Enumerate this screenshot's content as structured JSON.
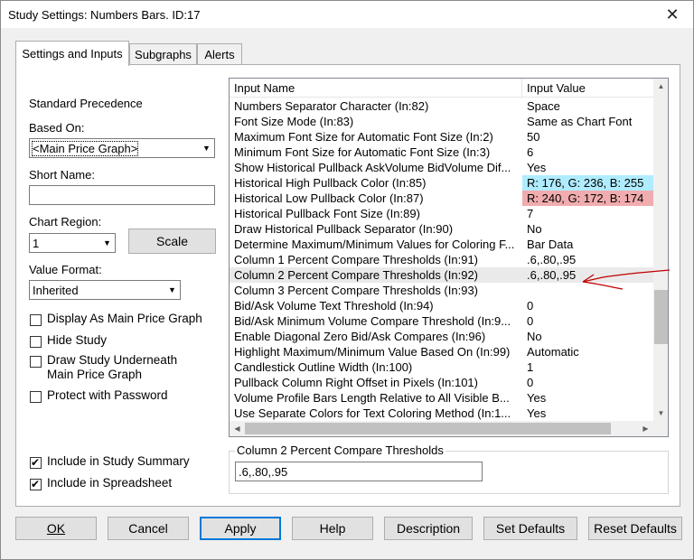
{
  "window": {
    "title": "Study Settings: Numbers Bars. ID:17",
    "close_glyph": "✕"
  },
  "tabs": [
    {
      "label": "Settings and Inputs",
      "active": true
    },
    {
      "label": "Subgraphs",
      "active": false
    },
    {
      "label": "Alerts",
      "active": false
    }
  ],
  "left": {
    "standard_precedence": "Standard Precedence",
    "based_on_label": "Based On:",
    "based_on_value": "<Main Price Graph>",
    "short_name_label": "Short Name:",
    "short_name_value": "",
    "chart_region_label": "Chart Region:",
    "chart_region_value": "1",
    "scale_button": "Scale",
    "value_format_label": "Value Format:",
    "value_format_value": "Inherited",
    "checkboxes": [
      {
        "label": "Display As Main Price Graph",
        "checked": false
      },
      {
        "label": "Hide Study",
        "checked": false
      },
      {
        "label": "Draw Study Underneath Main Price Graph",
        "checked": false
      },
      {
        "label": "Protect with Password",
        "checked": false
      }
    ],
    "bottom_checkboxes": [
      {
        "label": "Include in Study Summary",
        "checked": true
      },
      {
        "label": "Include in Spreadsheet",
        "checked": true
      }
    ]
  },
  "grid": {
    "col1_header": "Input Name",
    "col2_header": "Input Value",
    "rows": [
      {
        "name": "Numbers Separator Character   (In:82)",
        "value": "Space"
      },
      {
        "name": "Font Size Mode   (In:83)",
        "value": "Same as Chart Font"
      },
      {
        "name": "Maximum Font Size for Automatic Font Size   (In:2)",
        "value": "50"
      },
      {
        "name": "Minimum Font Size for Automatic Font Size   (In:3)",
        "value": "6"
      },
      {
        "name": "Show Historical Pullback AskVolume BidVolume Dif...",
        "value": "Yes"
      },
      {
        "name": "Historical High Pullback Color   (In:85)",
        "value": "R: 176, G: 236, B: 255",
        "bg": "#b0ecff"
      },
      {
        "name": "Historical Low Pullback Color   (In:87)",
        "value": "R: 240, G: 172, B: 174",
        "bg": "#f0acae"
      },
      {
        "name": "Historical Pullback Font Size   (In:89)",
        "value": "7"
      },
      {
        "name": "Draw Historical Pullback Separator   (In:90)",
        "value": "No"
      },
      {
        "name": "Determine Maximum/Minimum Values for Coloring F...",
        "value": "Bar Data"
      },
      {
        "name": "Column 1 Percent Compare Thresholds   (In:91)",
        "value": ".6,.80,.95"
      },
      {
        "name": "Column 2 Percent Compare Thresholds   (In:92)",
        "value": ".6,.80,.95",
        "selected": true
      },
      {
        "name": "Column 3 Percent Compare Thresholds   (In:93)",
        "value": ""
      },
      {
        "name": "Bid/Ask Volume Text Threshold   (In:94)",
        "value": "0"
      },
      {
        "name": "Bid/Ask Minimum Volume Compare Threshold   (In:9...",
        "value": "0"
      },
      {
        "name": "Enable Diagonal Zero Bid/Ask Compares   (In:96)",
        "value": "No"
      },
      {
        "name": "Highlight Maximum/Minimum Value Based On   (In:99)",
        "value": "Automatic"
      },
      {
        "name": "Candlestick Outline Width   (In:100)",
        "value": "1"
      },
      {
        "name": "Pullback Column Right Offset in Pixels   (In:101)",
        "value": "0"
      },
      {
        "name": "Volume Profile Bars Length Relative to All Visible B...",
        "value": "Yes"
      },
      {
        "name": "Use Separate Colors for Text Coloring Method   (In:1...",
        "value": "Yes"
      }
    ]
  },
  "editor": {
    "label": "Column 2 Percent Compare Thresholds",
    "value": ".6,.80,.95"
  },
  "buttons": {
    "ok": "OK",
    "cancel": "Cancel",
    "apply": "Apply",
    "help": "Help",
    "description": "Description",
    "set_defaults": "Set Defaults",
    "reset_defaults": "Reset Defaults"
  },
  "annotation": {
    "color": "#c00000"
  }
}
